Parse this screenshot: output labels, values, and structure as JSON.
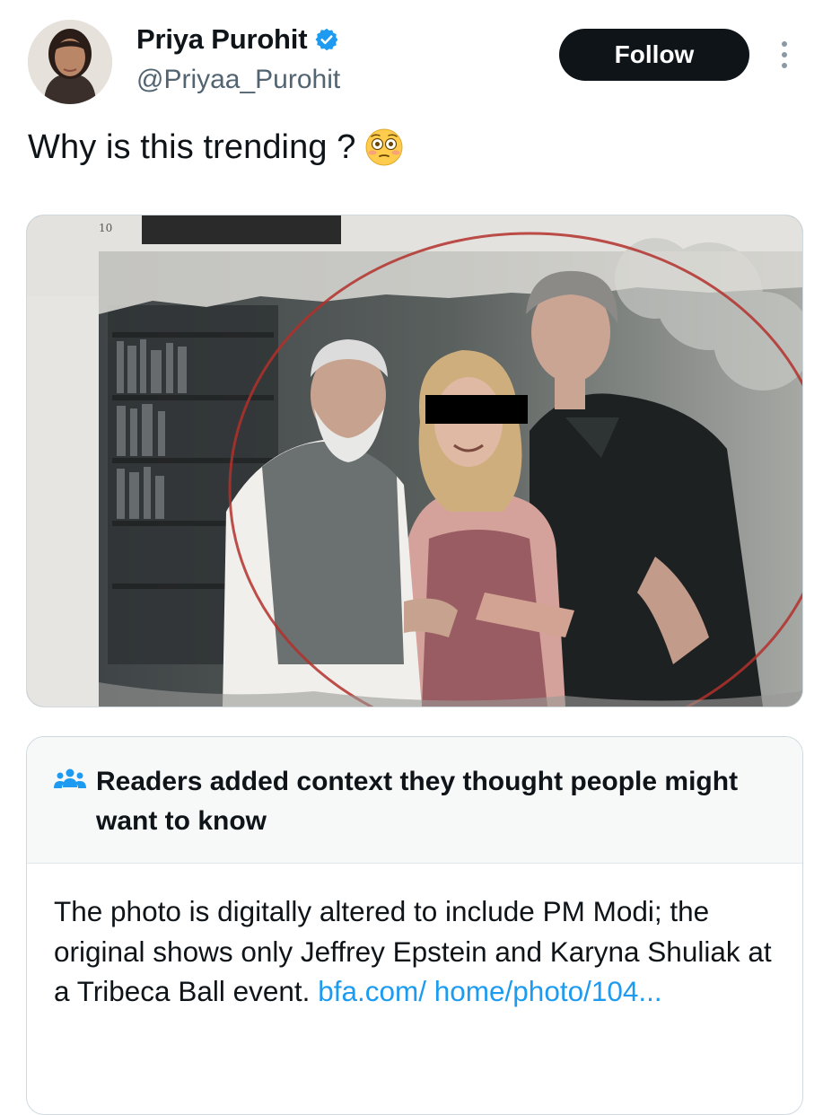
{
  "user": {
    "display_name": "Priya Purohit",
    "handle": "@Priyaa_Purohit",
    "verified_icon": "verified-badge-icon",
    "avatar": "user-avatar"
  },
  "actions": {
    "follow_label": "Follow",
    "more_icon": "more-options-icon"
  },
  "tweet": {
    "text": "Why is this trending ?",
    "emoji": "flushed-face-emoji"
  },
  "media": {
    "page_number": "10"
  },
  "community_note": {
    "icon": "people-icon",
    "title": "Readers added context they thought people might want to know",
    "body": "The photo is digitally altered to include PM Modi; the original shows only Jeffrey Epstein and Karyna Shuliak at a Tribeca Ball event.",
    "link_text": "bfa.com/ home/photo/104..."
  },
  "colors": {
    "accent_blue": "#1d9bf0",
    "text_primary": "#0f1419",
    "text_secondary": "#536471",
    "follow_button_bg": "#0f1419"
  }
}
